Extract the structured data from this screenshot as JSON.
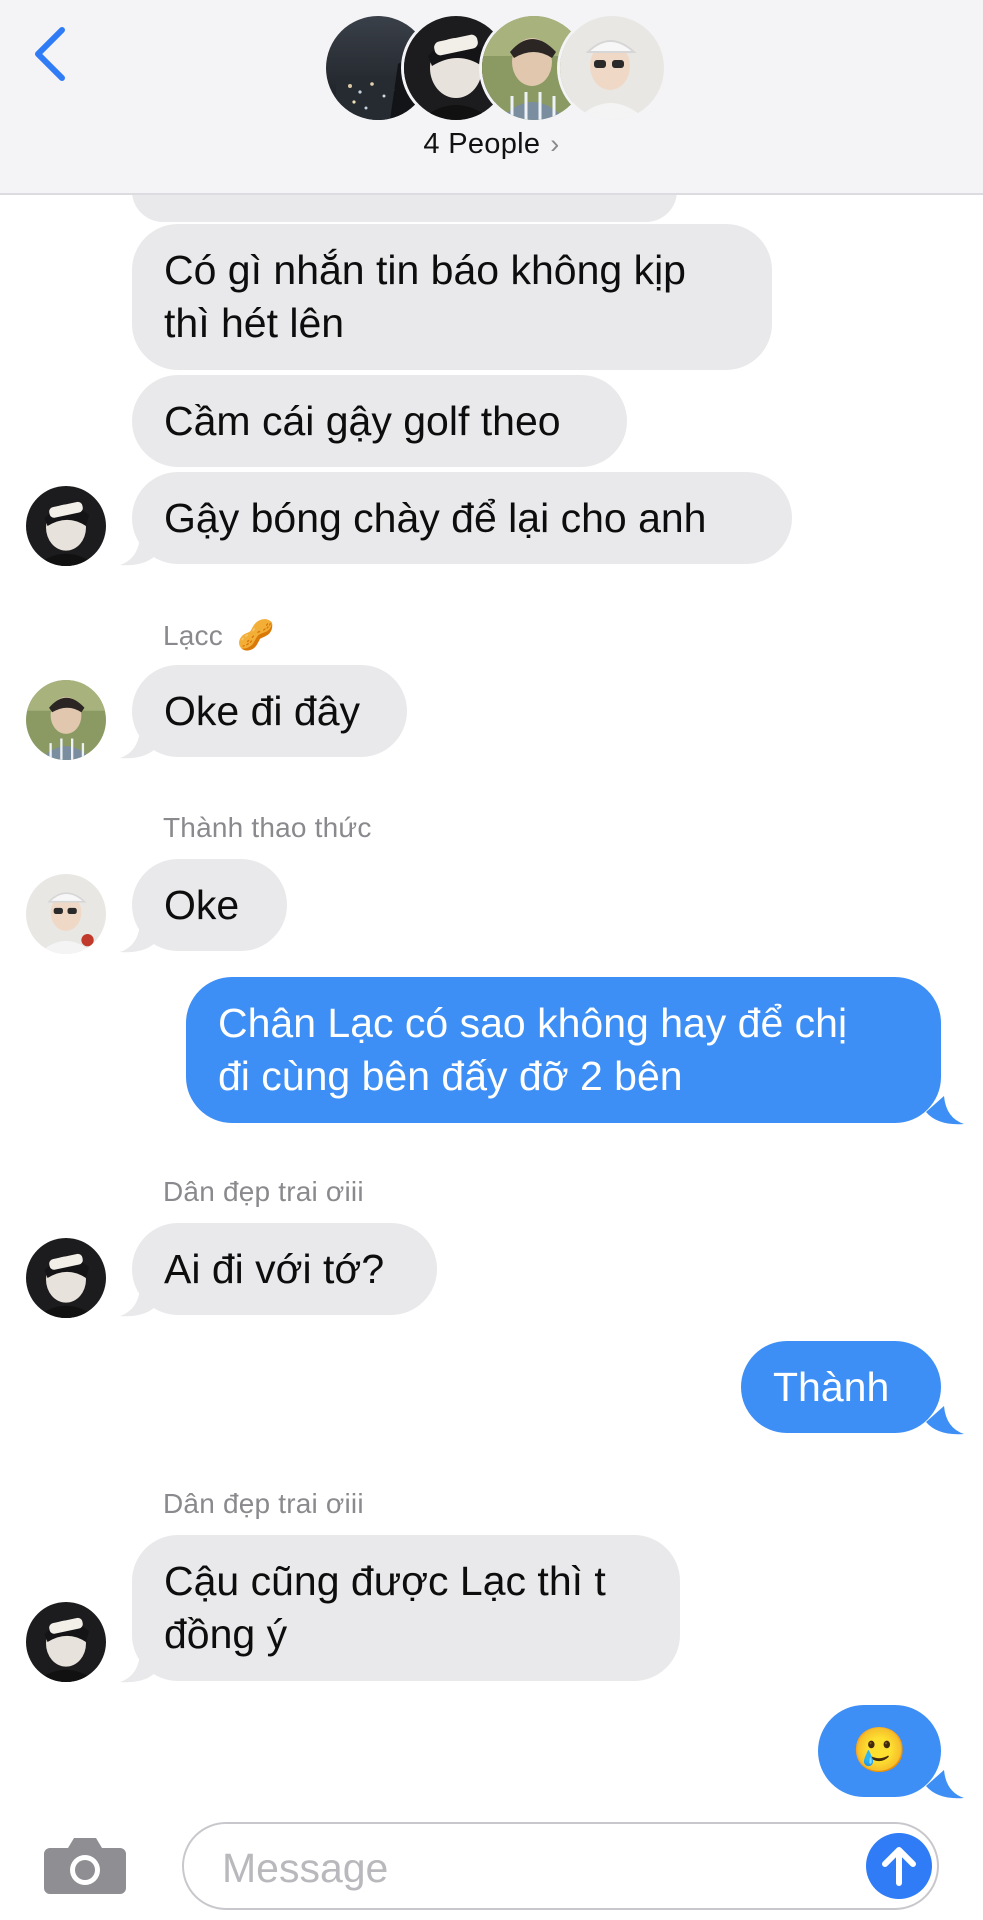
{
  "header": {
    "title": "4 People",
    "chevron": "›",
    "avatars": [
      "city-night-photo-avatar",
      "boy-dark-hoodie-avatar",
      "boy-striped-shirt-avatar",
      "boy-white-cap-avatar"
    ]
  },
  "messages": {
    "m1": {
      "lines": [
        "Có gì nhắn tin báo không kịp",
        "thì hét lên"
      ]
    },
    "m2": {
      "text": "Cầm cái gậy golf theo"
    },
    "m3": {
      "text": "Gậy bóng chày để lại cho anh"
    },
    "m4": {
      "sender": "Lạcc",
      "sender_emoji": "🥜",
      "text": "Oke đi đây"
    },
    "m5": {
      "sender": "Thành thao thức",
      "text": "Oke"
    },
    "m6": {
      "lines": [
        "Chân Lạc có sao không hay để chị",
        "đi cùng bên đấy đỡ 2 bên"
      ]
    },
    "m7": {
      "sender": "Dân đẹp trai ơiii",
      "text": "Ai đi với tớ?"
    },
    "m8": {
      "text": "Thành"
    },
    "m9": {
      "sender": "Dân đẹp trai ơiii",
      "lines": [
        "Cậu cũng được Lạc thì t",
        "đồng ý"
      ]
    },
    "m10": {
      "emoji": "🥲"
    }
  },
  "composer": {
    "placeholder": "Message",
    "camera_icon": "camera-icon",
    "send_icon": "arrow-up-icon"
  },
  "colors": {
    "incoming_bubble": "#e9e9eb",
    "outgoing_bubble": "#3d8ff5",
    "accent": "#2f7cf6",
    "header_bg": "#f4f4f6"
  }
}
